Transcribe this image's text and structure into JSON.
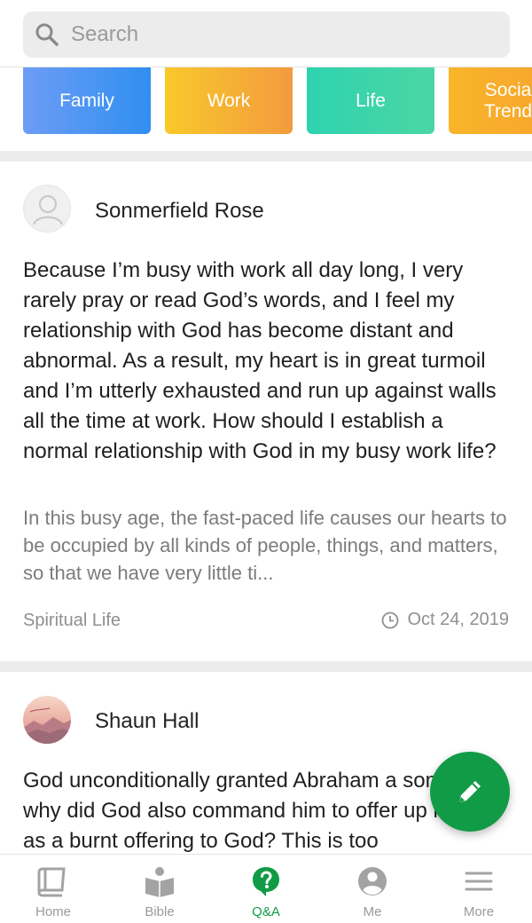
{
  "search": {
    "placeholder": "Search"
  },
  "categories": [
    {
      "label": "Family"
    },
    {
      "label": "Work"
    },
    {
      "label": "Life"
    },
    {
      "label": "Socia\nTrend"
    }
  ],
  "posts": [
    {
      "author": "Sonmerfield Rose",
      "question": "Because I’m busy with work all day long, I very rarely pray or read God’s words, and I feel my relationship with God has become distant and abnormal. As a result, my heart is in great turmoil and I’m utterly exhausted and run up against walls all the time at work. How should I establish a normal relationship with God in my busy work life?",
      "excerpt": "In this busy age, the fast-paced life causes our hearts to be occupied by all kinds of people, things, and matters, so that we have very little ti...",
      "tag": "Spiritual Life",
      "date": "Oct 24, 2019"
    },
    {
      "author": "Shaun Hall",
      "question": "God unconditionally granted Abraham a son, but why did God also command him to offer up his son as a burnt offering to God? This is too"
    }
  ],
  "tabs": [
    {
      "label": "Home",
      "icon": "book-icon"
    },
    {
      "label": "Bible",
      "icon": "reader-icon"
    },
    {
      "label": "Q&A",
      "icon": "question-icon"
    },
    {
      "label": "Me",
      "icon": "user-icon"
    },
    {
      "label": "More",
      "icon": "menu-icon"
    }
  ],
  "colors": {
    "accent": "#129b46"
  }
}
